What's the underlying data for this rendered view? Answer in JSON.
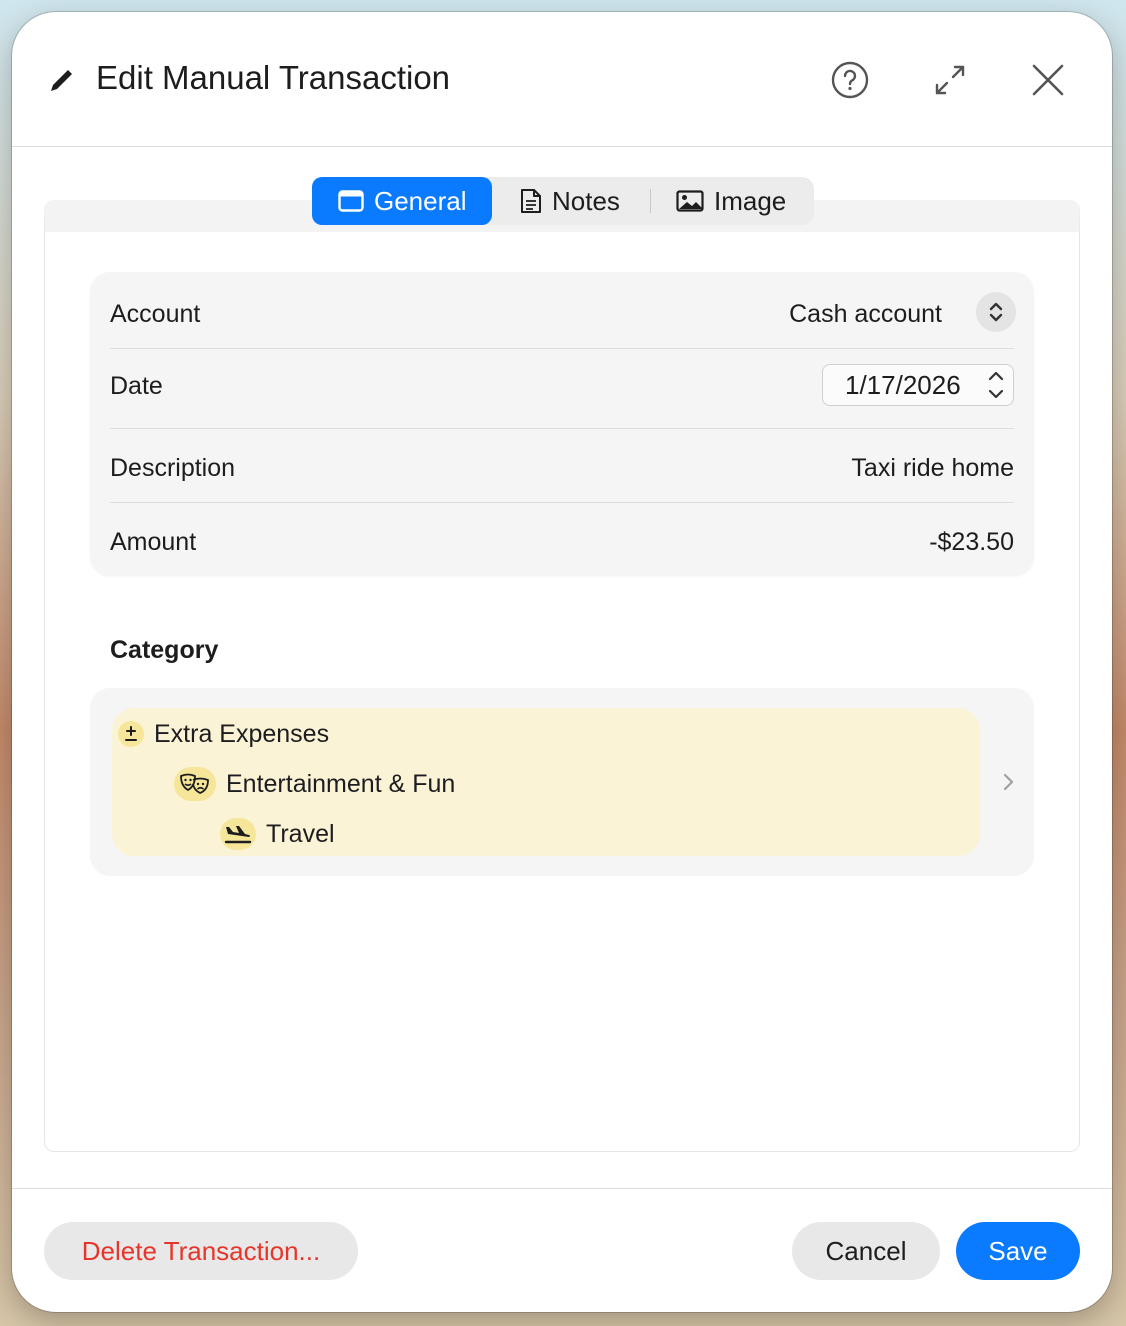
{
  "window": {
    "title": "Edit Manual Transaction",
    "icons": {
      "title": "pencil-icon",
      "help": "question-circle-icon",
      "expand": "expand-arrows-icon",
      "close": "close-icon"
    }
  },
  "tabs": [
    {
      "label": "General",
      "icon": "window-icon",
      "selected": true
    },
    {
      "label": "Notes",
      "icon": "document-icon",
      "selected": false
    },
    {
      "label": "Image",
      "icon": "photo-icon",
      "selected": false
    }
  ],
  "form": {
    "account": {
      "label": "Account",
      "value": "Cash account"
    },
    "date": {
      "label": "Date",
      "value": "1/17/2026"
    },
    "description": {
      "label": "Description",
      "value": "Taxi ride home"
    },
    "amount": {
      "label": "Amount",
      "value": "-$23.50"
    }
  },
  "category": {
    "title": "Category",
    "path": [
      {
        "label": "Extra Expenses",
        "icon": "plus-minus-icon"
      },
      {
        "label": "Entertainment & Fun",
        "icon": "theater-masks-icon"
      },
      {
        "label": "Travel",
        "icon": "airplane-landing-icon"
      }
    ]
  },
  "footer": {
    "delete_label": "Delete Transaction...",
    "cancel_label": "Cancel",
    "save_label": "Save"
  },
  "colors": {
    "accent": "#0a7aff",
    "destructive": "#e8352b",
    "category_highlight": "#fbf3d6",
    "category_icon_bg": "#f6e69a"
  }
}
